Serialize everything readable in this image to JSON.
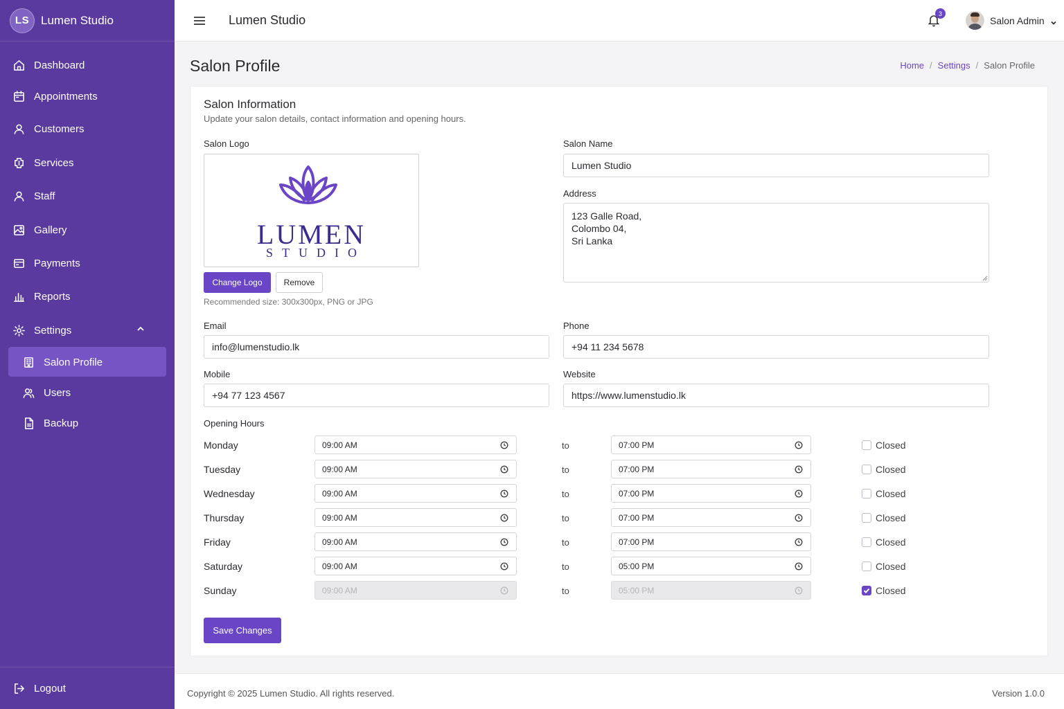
{
  "brand": {
    "initials": "LS",
    "name": "Lumen Studio"
  },
  "sidebar": {
    "items": [
      {
        "label": "Dashboard",
        "icon": "home-icon"
      },
      {
        "label": "Appointments",
        "icon": "calendar-icon"
      },
      {
        "label": "Customers",
        "icon": "user-icon"
      },
      {
        "label": "Services",
        "icon": "services-icon"
      },
      {
        "label": "Staff",
        "icon": "user-icon"
      },
      {
        "label": "Gallery",
        "icon": "image-icon"
      },
      {
        "label": "Payments",
        "icon": "card-icon"
      },
      {
        "label": "Reports",
        "icon": "bar-chart-icon"
      },
      {
        "label": "Settings",
        "icon": "gear-icon"
      }
    ],
    "settings_sub": [
      {
        "label": "Salon Profile",
        "icon": "building-icon",
        "active": true
      },
      {
        "label": "Users",
        "icon": "users-icon"
      },
      {
        "label": "Backup",
        "icon": "file-icon"
      }
    ],
    "logout": "Logout"
  },
  "topbar": {
    "title": "Lumen Studio",
    "notifications": "3",
    "user": "Salon Admin"
  },
  "page": {
    "title": "Salon Profile",
    "breadcrumb": {
      "home": "Home",
      "settings": "Settings",
      "current": "Salon Profile"
    }
  },
  "card": {
    "title": "Salon Information",
    "subtitle": "Update your salon details, contact information and opening hours.",
    "logo": {
      "label": "Salon Logo",
      "word1": "LUMEN",
      "word2": "STUDIO",
      "change": "Change Logo",
      "remove": "Remove",
      "hint": "Recommended size: 300x300px, PNG or JPG"
    },
    "fields": {
      "name_label": "Salon Name",
      "name": "Lumen Studio",
      "address_label": "Address",
      "address": "123 Galle Road,\nColombo 04,\nSri Lanka",
      "email_label": "Email",
      "email": "info@lumenstudio.lk",
      "phone_label": "Phone",
      "phone": "+94 11 234 5678",
      "mobile_label": "Mobile",
      "mobile": "+94 77 123 4567",
      "website_label": "Website",
      "website": "https://www.lumenstudio.lk"
    },
    "hours_label": "Opening Hours",
    "to": "to",
    "closed": "Closed",
    "hours": [
      {
        "day": "Monday",
        "open": "09:00 AM",
        "close": "07:00 PM",
        "closed": false
      },
      {
        "day": "Tuesday",
        "open": "09:00 AM",
        "close": "07:00 PM",
        "closed": false
      },
      {
        "day": "Wednesday",
        "open": "09:00 AM",
        "close": "07:00 PM",
        "closed": false
      },
      {
        "day": "Thursday",
        "open": "09:00 AM",
        "close": "07:00 PM",
        "closed": false
      },
      {
        "day": "Friday",
        "open": "09:00 AM",
        "close": "07:00 PM",
        "closed": false
      },
      {
        "day": "Saturday",
        "open": "09:00 AM",
        "close": "05:00 PM",
        "closed": false
      },
      {
        "day": "Sunday",
        "open": "09:00 AM",
        "close": "05:00 PM",
        "closed": true
      }
    ],
    "save": "Save Changes"
  },
  "footer": {
    "copyright": "Copyright © 2025 Lumen Studio. All rights reserved.",
    "version": "Version 1.0.0"
  },
  "colors": {
    "sidebar": "#5a3a9e",
    "accent": "#6a45c6",
    "active": "#7654c4"
  }
}
